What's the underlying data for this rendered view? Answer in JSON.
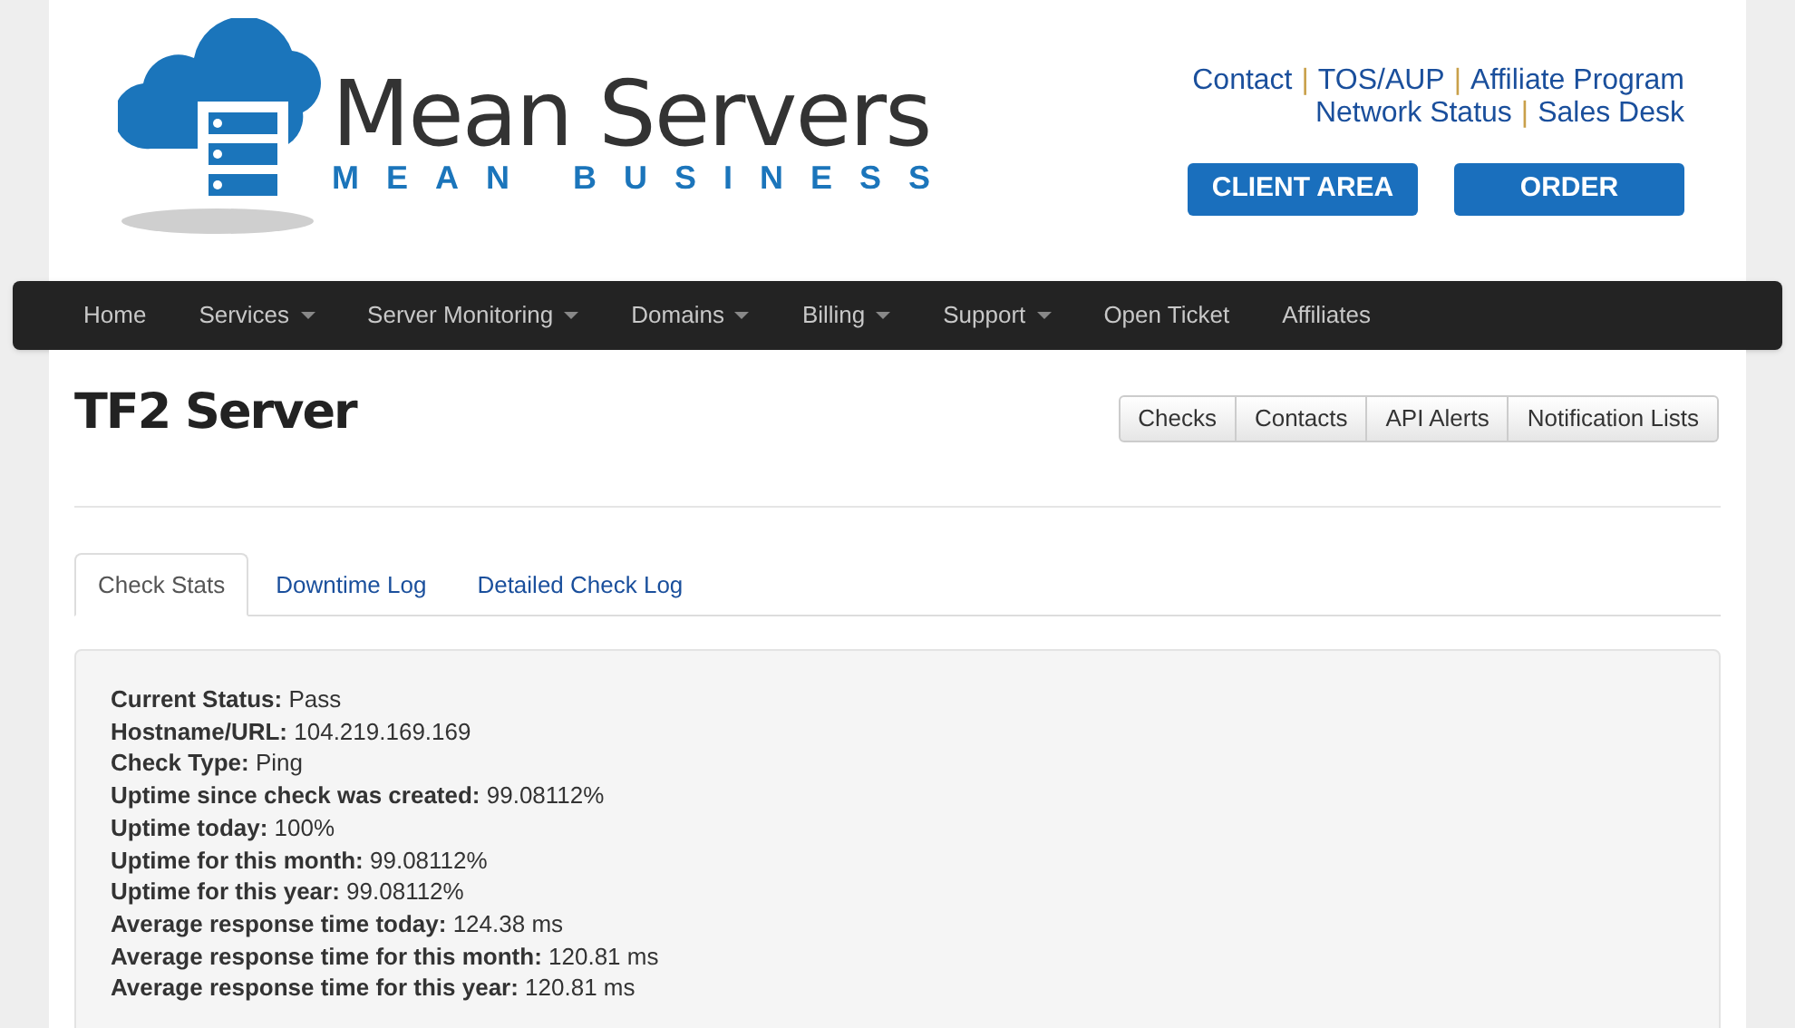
{
  "logo": {
    "title": "Mean Servers",
    "tagline": "MEAN BUSINESS"
  },
  "top_links": {
    "separator": "|",
    "rows": [
      {
        "links": [
          "Contact",
          "TOS/AUP",
          "Affiliate Program"
        ]
      },
      {
        "links": [
          "Network Status",
          "Sales Desk"
        ]
      }
    ]
  },
  "header_buttons": [
    "CLIENT AREA",
    "ORDER"
  ],
  "nav": [
    {
      "label": "Home",
      "dropdown": false
    },
    {
      "label": "Services",
      "dropdown": true
    },
    {
      "label": "Server Monitoring",
      "dropdown": true
    },
    {
      "label": "Domains",
      "dropdown": true
    },
    {
      "label": "Billing",
      "dropdown": true
    },
    {
      "label": "Support",
      "dropdown": true
    },
    {
      "label": "Open Ticket",
      "dropdown": false
    },
    {
      "label": "Affiliates",
      "dropdown": false
    }
  ],
  "page_title": "TF2 Server",
  "button_group": [
    "Checks",
    "Contacts",
    "API Alerts",
    "Notification Lists"
  ],
  "tabs": [
    {
      "label": "Check Stats",
      "selected": true
    },
    {
      "label": "Downtime Log",
      "selected": false
    },
    {
      "label": "Detailed Check Log",
      "selected": false
    }
  ],
  "stats": [
    "**Current Status:** Pass",
    "**Hostname/URL:** 104.219.169.169",
    "**Check Type:** Ping",
    "**Uptime since check was created:** 99.08112%",
    "**Uptime today:** 100%",
    "**Uptime for this month:** 99.08112%",
    "**Uptime for this year:** 99.08112%",
    "**Average response time today:** 124.38 ms",
    "**Average response time for this month:** 120.81 ms",
    "**Average response time for this year:** 120.81 ms"
  ]
}
